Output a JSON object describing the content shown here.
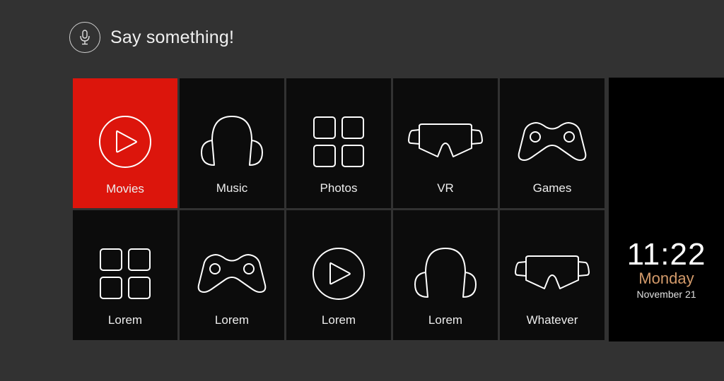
{
  "voice": {
    "prompt": "Say something!",
    "icon": "microphone-icon"
  },
  "tiles": [
    {
      "label": "Movies",
      "icon": "play-circle-icon",
      "active": true
    },
    {
      "label": "Music",
      "icon": "headphones-icon",
      "active": false
    },
    {
      "label": "Photos",
      "icon": "grid-icon",
      "active": false
    },
    {
      "label": "VR",
      "icon": "vr-headset-icon",
      "active": false
    },
    {
      "label": "Games",
      "icon": "gamepad-icon",
      "active": false
    },
    {
      "label": "Lorem",
      "icon": "grid-icon",
      "active": false
    },
    {
      "label": "Lorem",
      "icon": "gamepad-icon",
      "active": false
    },
    {
      "label": "Lorem",
      "icon": "play-circle-icon",
      "active": false
    },
    {
      "label": "Lorem",
      "icon": "headphones-icon",
      "active": false
    },
    {
      "label": "Whatever",
      "icon": "vr-headset-icon",
      "active": false
    }
  ],
  "clock": {
    "time": "11:22",
    "day": "Monday",
    "date": "November 21"
  },
  "colors": {
    "accent": "#dc150c",
    "tile": "#0c0c0c",
    "background": "#323232",
    "day": "#d39a6a"
  }
}
